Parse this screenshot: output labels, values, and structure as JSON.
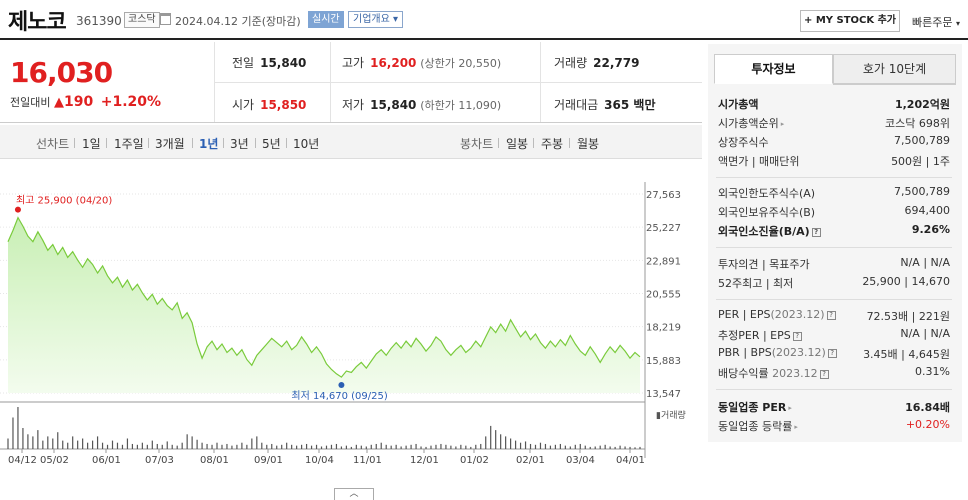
{
  "header": {
    "stock_name": "제노코",
    "stock_code": "361390",
    "market": "코스닥",
    "date_text": "2024.04.12 기준(장마감)",
    "realtime": "실시간",
    "company_overview": "기업개요",
    "mystock_button": "+ MY STOCK 추가",
    "quick_order": "빠른주문"
  },
  "price": {
    "current": "16,030",
    "change_label": "전일대비",
    "change_value": "190",
    "change_pct": "+1.20%",
    "prev_close_label": "전일",
    "prev_close": "15,840",
    "high_label": "고가",
    "high": "16,200",
    "upper_limit": "(상한가 20,550)",
    "volume_label": "거래량",
    "volume": "22,779",
    "open_label": "시가",
    "open": "15,850",
    "low_label": "저가",
    "low": "15,840",
    "lower_limit": "(하한가 11,090)",
    "amount_label": "거래대금",
    "amount": "365 백만"
  },
  "periods": {
    "line_label": "선차트",
    "line_items": [
      "1일",
      "1주일",
      "3개월",
      "1년",
      "3년",
      "5년",
      "10년"
    ],
    "active": "1년",
    "candle_label": "봉차트",
    "candle_items": [
      "일봉",
      "주봉",
      "월봉"
    ]
  },
  "chart_data": {
    "type": "area",
    "y_ticks": [
      "27,563",
      "25,227",
      "22,891",
      "20,555",
      "18,219",
      "15,883",
      "13,547"
    ],
    "ylim": [
      13547,
      27563
    ],
    "x_ticks": [
      "04/12",
      "05/02",
      "06/01",
      "07/03",
      "08/01",
      "09/01",
      "10/04",
      "11/01",
      "12/01",
      "01/02",
      "02/01",
      "03/04",
      "04/01"
    ],
    "high_annotation": "최고 25,900 (04/20)",
    "low_annotation": "최저 14,670 (09/25)",
    "volume_label": "거래량",
    "series": [
      {
        "values": [
          24200,
          25000,
          25900,
          25300,
          24600,
          24200,
          24900,
          24300,
          23600,
          24000,
          23300,
          23800,
          23100,
          23500,
          22900,
          22400,
          23000,
          22600,
          22000,
          22500,
          21800,
          21300,
          21700,
          21000,
          21500,
          20800,
          21200,
          20600,
          20100,
          20500,
          19800,
          20200,
          19700,
          19400,
          19900,
          18800,
          19200,
          18500,
          17000,
          16000,
          16800,
          17200,
          16600,
          17000,
          16400,
          16700,
          16200,
          16600,
          15900,
          15500,
          16200,
          16600,
          17000,
          17400,
          17100,
          16800,
          17200,
          16600,
          16900,
          17500,
          17000,
          16400,
          16800,
          16300,
          15600,
          15200,
          14900,
          14670,
          15100,
          15000,
          15400,
          15700,
          15300,
          15800,
          16300,
          16600,
          16200,
          16700,
          17100,
          16700,
          17200,
          16800,
          17400,
          17000,
          16500,
          16900,
          17500,
          17200,
          16600,
          16200,
          16600,
          16900,
          16400,
          16700,
          17200,
          16800,
          17500,
          18200,
          17800,
          18400,
          17900,
          18700,
          18100,
          17500,
          17900,
          17300,
          17700,
          17100,
          16700,
          17200,
          16800,
          17300,
          16900,
          17600,
          17000,
          16500,
          16200,
          16800,
          16300,
          15700,
          16300,
          16800,
          16400,
          16900,
          16500,
          16000,
          16400,
          16100
        ]
      }
    ],
    "volume": [
      0.25,
      0.75,
      1.0,
      0.5,
      0.35,
      0.3,
      0.45,
      0.2,
      0.3,
      0.25,
      0.4,
      0.2,
      0.15,
      0.3,
      0.2,
      0.25,
      0.15,
      0.2,
      0.3,
      0.15,
      0.1,
      0.2,
      0.15,
      0.1,
      0.25,
      0.12,
      0.1,
      0.15,
      0.1,
      0.2,
      0.12,
      0.1,
      0.18,
      0.1,
      0.08,
      0.15,
      0.35,
      0.3,
      0.22,
      0.15,
      0.12,
      0.1,
      0.15,
      0.1,
      0.12,
      0.08,
      0.1,
      0.15,
      0.1,
      0.25,
      0.3,
      0.15,
      0.1,
      0.12,
      0.08,
      0.1,
      0.15,
      0.1,
      0.08,
      0.1,
      0.12,
      0.08,
      0.1,
      0.06,
      0.08,
      0.1,
      0.12,
      0.06,
      0.08,
      0.05,
      0.1,
      0.08,
      0.06,
      0.1,
      0.12,
      0.15,
      0.1,
      0.08,
      0.1,
      0.06,
      0.08,
      0.1,
      0.12,
      0.06,
      0.05,
      0.08,
      0.1,
      0.12,
      0.1,
      0.08,
      0.06,
      0.1,
      0.08,
      0.05,
      0.1,
      0.12,
      0.3,
      0.55,
      0.45,
      0.35,
      0.3,
      0.25,
      0.2,
      0.15,
      0.18,
      0.12,
      0.1,
      0.15,
      0.12,
      0.08,
      0.1,
      0.12,
      0.08,
      0.06,
      0.1,
      0.12,
      0.08,
      0.05,
      0.06,
      0.08,
      0.1,
      0.06,
      0.05,
      0.08,
      0.06,
      0.05,
      0.04,
      0.05
    ]
  },
  "right_panel": {
    "tab_active": "투자정보",
    "tab_inactive": "호가 10단계",
    "market_cap_label": "시가총액",
    "market_cap": "1,202억원",
    "market_cap_rank_label": "시가총액순위",
    "market_cap_rank": "코스닥 698위",
    "shares_label": "상장주식수",
    "shares": "7,500,789",
    "par_label": "액면가 | 매매단위",
    "par": "500원 | 1주",
    "foreign_limit_label": "외국인한도주식수(A)",
    "foreign_limit": "7,500,789",
    "foreign_hold_label": "외국인보유주식수(B)",
    "foreign_hold": "694,400",
    "foreign_rate_label": "외국인소진율(B/A)",
    "foreign_rate": "9.26%",
    "opinion_label": "투자의견 | 목표주가",
    "opinion": "N/A | N/A",
    "week52_label": "52주최고 | 최저",
    "week52": "25,900 | 14,670",
    "per_label": "PER | EPS",
    "per_period": "(2023.12)",
    "per": "72.53배 | 221원",
    "est_per_label": "추정PER | EPS",
    "est_per": "N/A | N/A",
    "pbr_label": "PBR | BPS",
    "pbr_period": "(2023.12)",
    "pbr": "3.45배 | 4,645원",
    "dividend_label": "배당수익률",
    "dividend_period": "2023.12",
    "dividend": "0.31%",
    "sector_per_label": "동일업종 PER",
    "sector_per": "16.84배",
    "sector_rate_label": "동일업종 등락률",
    "sector_rate": "+0.20%"
  }
}
